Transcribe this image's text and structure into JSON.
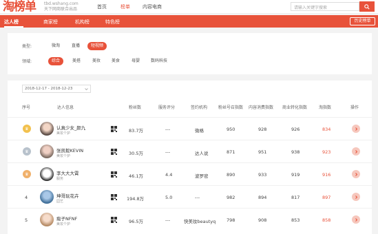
{
  "header": {
    "logo": "淘榜单",
    "site_url": "tbd.wshang.com",
    "site_slogan": "天下网商联合出品",
    "nav": [
      "首页",
      "榜单",
      "内容电商"
    ],
    "active_nav": 1,
    "search_placeholder": "请输入关键字搜索"
  },
  "redbar": {
    "tabs": [
      "达人榜",
      "商家榜",
      "机构榜",
      "特色榜"
    ],
    "active_tab": 0,
    "history_label": "历史榜单"
  },
  "filters": {
    "type_label": "类型:",
    "type_options": [
      "微淘",
      "直播",
      "短视频"
    ],
    "type_active": 2,
    "field_label": "领域:",
    "field_options": [
      "综合",
      "美搭",
      "美妆",
      "美食",
      "母婴",
      "数码科技"
    ],
    "field_active": 0
  },
  "table": {
    "date_range": "2018-12-17 - 2018-12-23",
    "columns": [
      "序号",
      "达人信息",
      "粉丝数",
      "服务评分",
      "签约机构",
      "粉丝号召指数",
      "内容消费指数",
      "商业转化指数",
      "淘指数",
      "操作"
    ],
    "rows": [
      {
        "rank": "1",
        "name": "认真少女_颜九",
        "category": "美妆个护",
        "fans": "83.7万",
        "score": "---",
        "agency": "微格",
        "fan_idx": "950",
        "content_idx": "928",
        "biz_idx": "926",
        "tao_idx": "834"
      },
      {
        "rank": "2",
        "name": "张凯毅KEVIN",
        "category": "美妆个护",
        "fans": "30.5万",
        "score": "---",
        "agency": "达人说",
        "fan_idx": "871",
        "content_idx": "951",
        "biz_idx": "938",
        "tao_idx": "923"
      },
      {
        "rank": "3",
        "name": "李大大大霄",
        "category": "服务",
        "fans": "46.1万",
        "score": "4.4",
        "agency": "波罗密",
        "fan_idx": "890",
        "content_idx": "933",
        "biz_idx": "919",
        "tao_idx": "916"
      },
      {
        "rank": "4",
        "name": "坤哥玩花卉",
        "category": "园艺",
        "fans": "194.8万",
        "score": "5.0",
        "agency": "---",
        "fan_idx": "982",
        "content_idx": "894",
        "biz_idx": "817",
        "tao_idx": "897"
      },
      {
        "rank": "5",
        "name": "痴子NFNF",
        "category": "美妆个护",
        "fans": "96.5万",
        "score": "---",
        "agency": "快美妆beautyq",
        "fan_idx": "798",
        "content_idx": "908",
        "biz_idx": "853",
        "tao_idx": "858"
      }
    ]
  },
  "colors": {
    "accent": "#e8523a",
    "gold": "#f2c14e",
    "silver": "#b8c2cc",
    "bronze": "#f0b06a"
  }
}
